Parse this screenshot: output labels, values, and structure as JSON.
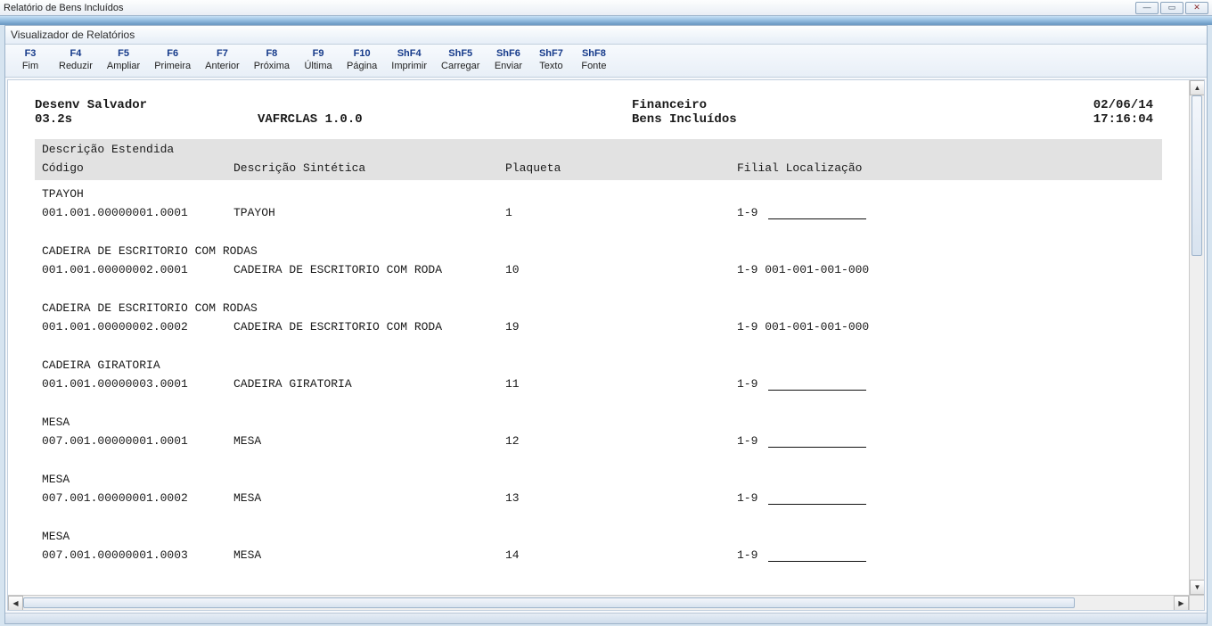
{
  "outer": {
    "title": "Relatório de Bens Incluídos"
  },
  "inner": {
    "title": "Visualizador de Relatórios"
  },
  "toolbar": [
    {
      "key": "F3",
      "label": "Fim"
    },
    {
      "key": "F4",
      "label": "Reduzir"
    },
    {
      "key": "F5",
      "label": "Ampliar"
    },
    {
      "key": "F6",
      "label": "Primeira"
    },
    {
      "key": "F7",
      "label": "Anterior"
    },
    {
      "key": "F8",
      "label": "Próxima"
    },
    {
      "key": "F9",
      "label": "Última"
    },
    {
      "key": "F10",
      "label": "Página"
    },
    {
      "key": "ShF4",
      "label": "Imprimir"
    },
    {
      "key": "ShF5",
      "label": "Carregar"
    },
    {
      "key": "ShF6",
      "label": "Enviar"
    },
    {
      "key": "ShF7",
      "label": "Texto"
    },
    {
      "key": "ShF8",
      "label": "Fonte"
    }
  ],
  "report": {
    "header": {
      "line1": {
        "left": "Desenv Salvador",
        "center": "",
        "right1": "Financeiro",
        "right2": "02/06/14"
      },
      "line2": {
        "left": "03.2s",
        "center": "VAFRCLAS 1.0.0",
        "right1": "Bens Incluídos",
        "right2": "17:16:04"
      }
    },
    "band": {
      "row1": "Descrição Estendida",
      "cols": {
        "codigo": "Código",
        "desc": "Descrição Sintética",
        "plaqueta": "Plaqueta",
        "loc": "Filial Localização"
      }
    },
    "groups": [
      {
        "desc_ext": "TPAYOH",
        "rows": [
          {
            "codigo": "001.001.00000001.0001",
            "desc": "TPAYOH",
            "plaqueta": "1",
            "filial": "1-9",
            "loc": ""
          }
        ]
      },
      {
        "desc_ext": "CADEIRA DE ESCRITORIO COM RODAS",
        "rows": [
          {
            "codigo": "001.001.00000002.0001",
            "desc": "CADEIRA DE ESCRITORIO COM RODA",
            "plaqueta": "10",
            "filial": "1-9",
            "loc": "001-001-001-000"
          }
        ]
      },
      {
        "desc_ext": "CADEIRA DE ESCRITORIO COM RODAS",
        "rows": [
          {
            "codigo": "001.001.00000002.0002",
            "desc": "CADEIRA DE ESCRITORIO COM RODA",
            "plaqueta": "19",
            "filial": "1-9",
            "loc": "001-001-001-000"
          }
        ]
      },
      {
        "desc_ext": "CADEIRA GIRATORIA",
        "rows": [
          {
            "codigo": "001.001.00000003.0001",
            "desc": "CADEIRA GIRATORIA",
            "plaqueta": "11",
            "filial": "1-9",
            "loc": ""
          }
        ]
      },
      {
        "desc_ext": "MESA",
        "rows": [
          {
            "codigo": "007.001.00000001.0001",
            "desc": "MESA",
            "plaqueta": "12",
            "filial": "1-9",
            "loc": ""
          }
        ]
      },
      {
        "desc_ext": "MESA",
        "rows": [
          {
            "codigo": "007.001.00000001.0002",
            "desc": "MESA",
            "plaqueta": "13",
            "filial": "1-9",
            "loc": ""
          }
        ]
      },
      {
        "desc_ext": "MESA",
        "rows": [
          {
            "codigo": "007.001.00000001.0003",
            "desc": "MESA",
            "plaqueta": "14",
            "filial": "1-9",
            "loc": ""
          }
        ]
      }
    ]
  }
}
